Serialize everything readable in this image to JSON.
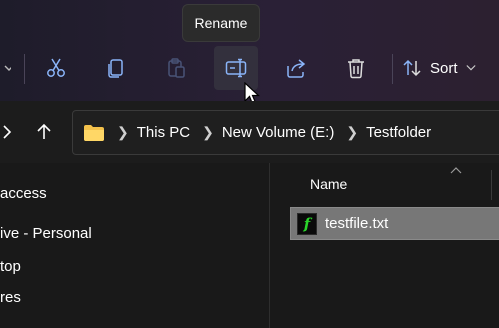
{
  "toolbar": {
    "buttons": [
      {
        "icon": "cut-icon",
        "label": "Cut"
      },
      {
        "icon": "copy-icon",
        "label": "Copy"
      },
      {
        "icon": "paste-icon",
        "label": "Paste"
      },
      {
        "icon": "rename-icon",
        "label": "Rename"
      },
      {
        "icon": "share-icon",
        "label": "Share"
      },
      {
        "icon": "delete-icon",
        "label": "Delete"
      }
    ],
    "sort_label": "Sort",
    "tooltip": "Rename"
  },
  "address_bar": {
    "crumbs": [
      "This PC",
      "New Volume (E:)",
      "Testfolder"
    ]
  },
  "nav_pane": {
    "items": [
      "access",
      "ive - Personal",
      "top",
      "res"
    ]
  },
  "file_list": {
    "column_name": "Name",
    "files": [
      {
        "name": "testfile.txt",
        "icon_glyph": "f",
        "selected": true
      }
    ]
  },
  "colors": {
    "accent_icon": "#8ab4f8",
    "selection": "#777777",
    "file_icon_green": "#2ad32a"
  }
}
